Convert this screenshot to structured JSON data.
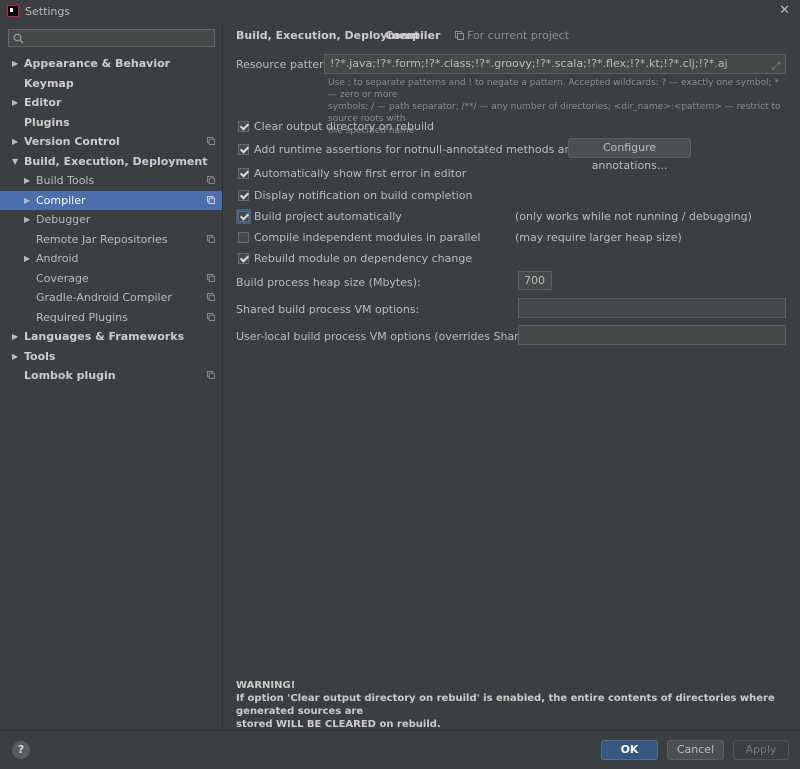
{
  "window": {
    "title": "Settings"
  },
  "sidebar": {
    "search_placeholder": "",
    "items": [
      {
        "label": "Appearance & Behavior",
        "bold": true,
        "level": 0,
        "arrow": "▶",
        "proj": false,
        "selected": false
      },
      {
        "label": "Keymap",
        "bold": true,
        "level": 0,
        "arrow": "",
        "proj": false,
        "selected": false
      },
      {
        "label": "Editor",
        "bold": true,
        "level": 0,
        "arrow": "▶",
        "proj": false,
        "selected": false
      },
      {
        "label": "Plugins",
        "bold": true,
        "level": 0,
        "arrow": "",
        "proj": false,
        "selected": false
      },
      {
        "label": "Version Control",
        "bold": true,
        "level": 0,
        "arrow": "▶",
        "proj": true,
        "selected": false
      },
      {
        "label": "Build, Execution, Deployment",
        "bold": true,
        "level": 0,
        "arrow": "▼",
        "proj": false,
        "selected": false
      },
      {
        "label": "Build Tools",
        "bold": false,
        "level": 1,
        "arrow": "▶",
        "proj": true,
        "selected": false
      },
      {
        "label": "Compiler",
        "bold": false,
        "level": 1,
        "arrow": "▶",
        "proj": true,
        "selected": true
      },
      {
        "label": "Debugger",
        "bold": false,
        "level": 1,
        "arrow": "▶",
        "proj": false,
        "selected": false
      },
      {
        "label": "Remote Jar Repositories",
        "bold": false,
        "level": 1,
        "arrow": "",
        "proj": true,
        "selected": false
      },
      {
        "label": "Android",
        "bold": false,
        "level": 1,
        "arrow": "▶",
        "proj": false,
        "selected": false
      },
      {
        "label": "Coverage",
        "bold": false,
        "level": 1,
        "arrow": "",
        "proj": true,
        "selected": false
      },
      {
        "label": "Gradle-Android Compiler",
        "bold": false,
        "level": 1,
        "arrow": "",
        "proj": true,
        "selected": false
      },
      {
        "label": "Required Plugins",
        "bold": false,
        "level": 1,
        "arrow": "",
        "proj": true,
        "selected": false
      },
      {
        "label": "Languages & Frameworks",
        "bold": true,
        "level": 0,
        "arrow": "▶",
        "proj": false,
        "selected": false
      },
      {
        "label": "Tools",
        "bold": true,
        "level": 0,
        "arrow": "▶",
        "proj": false,
        "selected": false
      },
      {
        "label": "Lombok plugin",
        "bold": true,
        "level": 0,
        "arrow": "",
        "proj": true,
        "selected": false
      }
    ]
  },
  "breadcrumb": {
    "parent": "Build, Execution, Deployment",
    "separator": "›",
    "current": "Compiler",
    "scope": "For current project"
  },
  "compiler": {
    "resource_label": "Resource patterns:",
    "resource_value": "!?*.java;!?*.form;!?*.class;!?*.groovy;!?*.scala;!?*.flex;!?*.kt;!?*.clj;!?*.aj",
    "resource_hint_1": "Use ; to separate patterns and ! to negate a pattern. Accepted wildcards: ? — exactly one symbol; * — zero or more",
    "resource_hint_2": "symbols; / — path separator; /**/ — any number of directories; <dir_name>:<pattern> — restrict to source roots with",
    "resource_hint_3": "the specified name",
    "configure_button": "Configure annotations...",
    "options": [
      {
        "label": "Clear output directory on rebuild",
        "checked": true,
        "note": ""
      },
      {
        "label": "Add runtime assertions for notnull-annotated methods and parameters",
        "checked": true,
        "note": ""
      },
      {
        "label": "Automatically show first error in editor",
        "checked": true,
        "note": ""
      },
      {
        "label": "Display notification on build completion",
        "checked": true,
        "note": ""
      },
      {
        "label": "Build project automatically",
        "checked": true,
        "note": "(only works while not running / debugging)"
      },
      {
        "label": "Compile independent modules in parallel",
        "checked": false,
        "note": "(may require larger heap size)"
      },
      {
        "label": "Rebuild module on dependency change",
        "checked": true,
        "note": ""
      }
    ],
    "heap_label": "Build process heap size (Mbytes):",
    "heap_value": "700",
    "shared_vm_label": "Shared build process VM options:",
    "shared_vm_value": "",
    "user_vm_label": "User-local build process VM options (overrides Shared options):",
    "user_vm_value": "",
    "warning_title": "WARNING!",
    "warning_line1": "If option 'Clear output directory on rebuild' is enabled, the entire contents of directories where generated sources are",
    "warning_line2": "stored WILL BE CLEARED on rebuild."
  },
  "footer": {
    "help": "?",
    "ok": "OK",
    "cancel": "Cancel",
    "apply": "Apply"
  }
}
